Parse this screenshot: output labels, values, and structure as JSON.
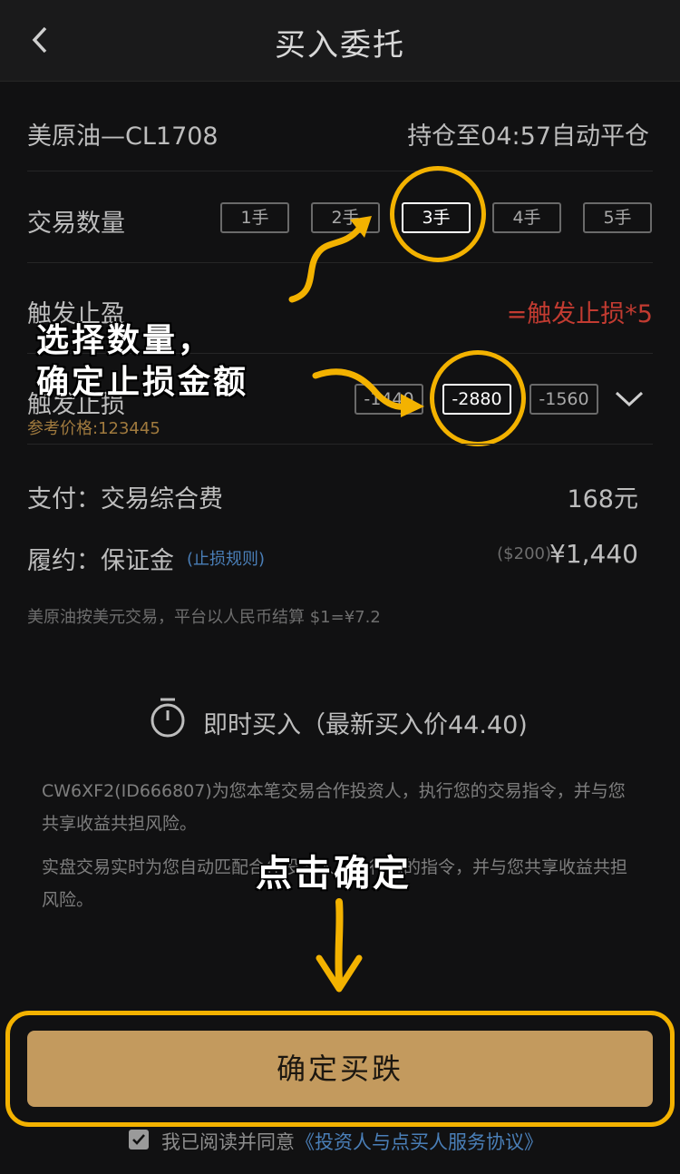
{
  "header": {
    "title": "买入委托"
  },
  "product": {
    "name": "美原油—CL1708",
    "hold_until": "持仓至04:57自动平仓"
  },
  "quantity": {
    "label": "交易数量",
    "options": [
      "1手",
      "2手",
      "3手",
      "4手",
      "5手"
    ],
    "selected": "3手"
  },
  "take_profit": {
    "label": "触发止盈",
    "value": "=触发止损*5",
    "value_color": "#c23b31"
  },
  "stop_loss": {
    "label": "触发止损",
    "ref_price": "参考价格:123445",
    "options": [
      "-1440",
      "-2880",
      "-1560"
    ],
    "selected": "-2880"
  },
  "fees": {
    "pay_label": "支付：交易综合费",
    "pay_value": "168元",
    "margin_label": "履约：保证金",
    "margin_link": "(止损规则)",
    "margin_usd": "($200)",
    "margin_value": "¥1,440"
  },
  "fx_note": "美原油按美元交易，平台以人民币结算 $1=¥7.2",
  "instant_buy": {
    "icon": "stopwatch-icon",
    "text": "即时买入（最新买入价44.40)"
  },
  "notes": [
    "CW6XF2(ID666807)为您本笔交易合作投资人，执行您的交易指令，并与您共享收益共担风险。",
    "实盘交易实时为您自动匹配合作投资人，执行您的指令，并与您共享收益共担风险。"
  ],
  "annotations": {
    "select_line1": "选择数量，",
    "select_line2": "确定止损金额",
    "click": "点击确定",
    "highlight_color": "#f3b200"
  },
  "confirm_button": "确定买跌",
  "agreement": {
    "prefix": "我已阅读并同意",
    "link": "《投资人与点买人服务协议》",
    "checked": true
  },
  "colors": {
    "accent": "#c39a5e",
    "link": "#4a7fb8",
    "background": "#111112"
  }
}
